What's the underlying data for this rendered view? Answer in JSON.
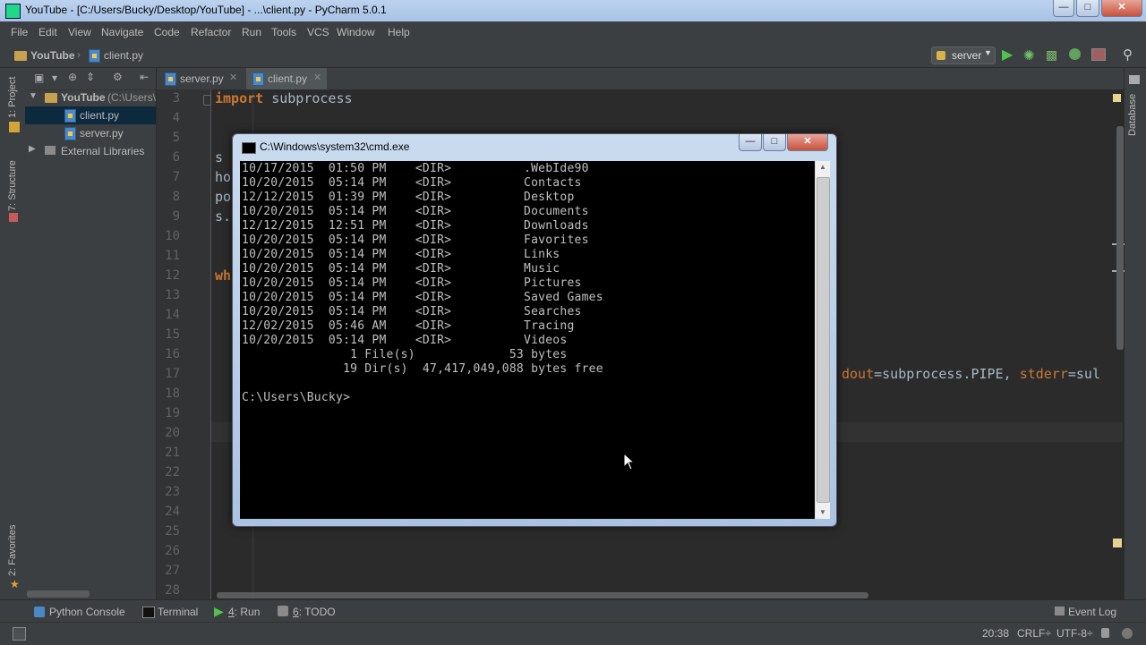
{
  "window": {
    "title": "YouTube - [C:/Users/Bucky/Desktop/YouTube] - ...\\client.py - PyCharm 5.0.1"
  },
  "menu": [
    "File",
    "Edit",
    "View",
    "Navigate",
    "Code",
    "Refactor",
    "Run",
    "Tools",
    "VCS",
    "Window",
    "Help"
  ],
  "breadcrumb": {
    "project": "YouTube",
    "file": "client.py"
  },
  "run_config": {
    "name": "server"
  },
  "left_strip": {
    "project_label": "1: Project",
    "structure_label": "7: Structure",
    "favorites_label": "2: Favorites"
  },
  "project_tree": {
    "root": "YouTube",
    "root_path": "(C:\\Users\\",
    "files": [
      "client.py",
      "server.py"
    ],
    "external": "External Libraries"
  },
  "tabs": [
    {
      "label": "server.py"
    },
    {
      "label": "client.py"
    }
  ],
  "editor": {
    "line_numbers": [
      "3",
      "4",
      "5",
      "6",
      "7",
      "8",
      "9",
      "10",
      "11",
      "12",
      "13",
      "14",
      "15",
      "16",
      "17",
      "18",
      "19",
      "20",
      "21",
      "22",
      "23",
      "24",
      "25",
      "26",
      "27",
      "28"
    ],
    "line3_kw": "import",
    "line3_rest": " subprocess",
    "frag6": "s",
    "frag7": "ho",
    "frag8": "po",
    "frag9": "s.",
    "frag12": "wh",
    "line17_a": "dout",
    "line17_b": "=subprocess.PIPE, ",
    "line17_c": "stderr",
    "line17_d": "=sul"
  },
  "right_strip": {
    "database_label": "Database"
  },
  "cmd": {
    "title": "C:\\Windows\\system32\\cmd.exe",
    "lines": [
      "10/17/2015  01:50 PM    <DIR>          .WebIde90",
      "10/20/2015  05:14 PM    <DIR>          Contacts",
      "12/12/2015  01:39 PM    <DIR>          Desktop",
      "10/20/2015  05:14 PM    <DIR>          Documents",
      "12/12/2015  12:51 PM    <DIR>          Downloads",
      "10/20/2015  05:14 PM    <DIR>          Favorites",
      "10/20/2015  05:14 PM    <DIR>          Links",
      "10/20/2015  05:14 PM    <DIR>          Music",
      "10/20/2015  05:14 PM    <DIR>          Pictures",
      "10/20/2015  05:14 PM    <DIR>          Saved Games",
      "10/20/2015  05:14 PM    <DIR>          Searches",
      "12/02/2015  05:46 AM    <DIR>          Tracing",
      "10/20/2015  05:14 PM    <DIR>          Videos",
      "               1 File(s)             53 bytes",
      "              19 Dir(s)  47,417,049,088 bytes free",
      "",
      "C:\\Users\\Bucky>"
    ]
  },
  "bottom_tools": {
    "python_console": "Python Console",
    "terminal": "Terminal",
    "run_num": "4",
    "run": ": Run",
    "todo_num": "6",
    "todo": ": TODO",
    "event_log": "Event Log"
  },
  "status": {
    "position": "20:38",
    "line_sep": "CRLF÷",
    "encoding": "UTF-8÷"
  }
}
